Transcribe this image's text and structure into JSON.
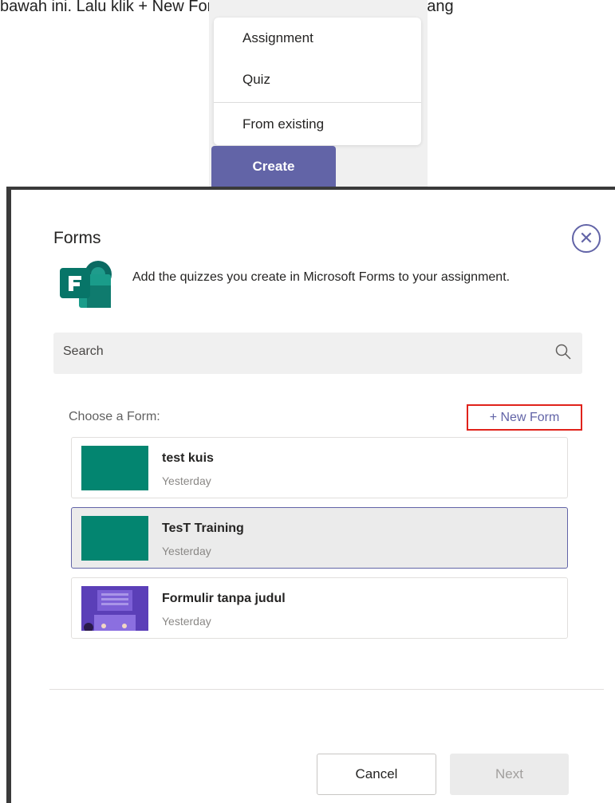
{
  "caption": "bawah ini. Lalu klik + New Form untuk membuat form ujian yang",
  "create_menu": {
    "items": [
      {
        "label": "Assignment"
      },
      {
        "label": "Quiz"
      },
      {
        "label": "From existing"
      }
    ],
    "create_label": "Create"
  },
  "dialog": {
    "title": "Forms",
    "close_icon": "close-circle-icon",
    "description": "Add the quizzes you create in Microsoft Forms to your assignment.",
    "search": {
      "placeholder": "Search",
      "icon": "search-icon"
    },
    "choose_label": "Choose a Form:",
    "new_form_label": "+ New Form",
    "forms": [
      {
        "name": "test kuis",
        "date": "Yesterday",
        "thumbnail": "teal"
      },
      {
        "name": "TesT Training",
        "date": "Yesterday",
        "thumbnail": "teal",
        "selected": true
      },
      {
        "name": "Formulir tanpa judul",
        "date": "Yesterday",
        "thumbnail": "illustration"
      }
    ],
    "cancel_label": "Cancel",
    "next_label": "Next"
  },
  "colors": {
    "accent": "#6264a7",
    "thumbnail_teal": "#038570",
    "highlight_border": "#e0221b"
  }
}
